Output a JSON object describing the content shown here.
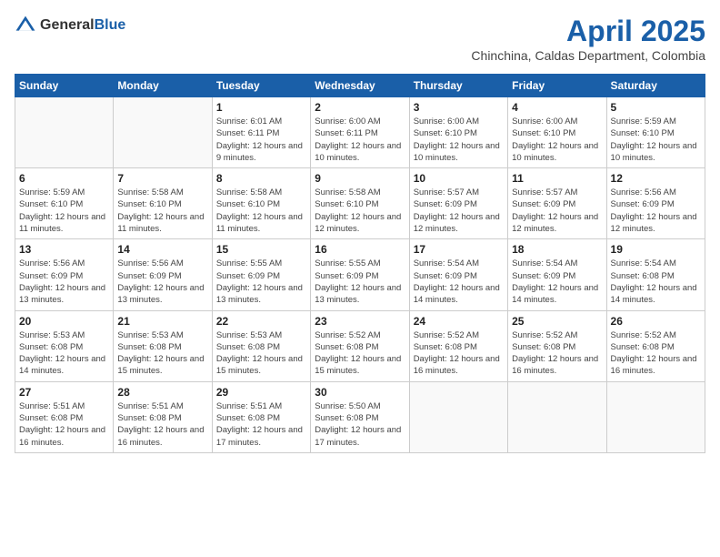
{
  "header": {
    "logo_general": "General",
    "logo_blue": "Blue",
    "month_year": "April 2025",
    "location": "Chinchina, Caldas Department, Colombia"
  },
  "days_of_week": [
    "Sunday",
    "Monday",
    "Tuesday",
    "Wednesday",
    "Thursday",
    "Friday",
    "Saturday"
  ],
  "weeks": [
    [
      {
        "day": "",
        "info": ""
      },
      {
        "day": "",
        "info": ""
      },
      {
        "day": "1",
        "info": "Sunrise: 6:01 AM\nSunset: 6:11 PM\nDaylight: 12 hours and 9 minutes."
      },
      {
        "day": "2",
        "info": "Sunrise: 6:00 AM\nSunset: 6:11 PM\nDaylight: 12 hours and 10 minutes."
      },
      {
        "day": "3",
        "info": "Sunrise: 6:00 AM\nSunset: 6:10 PM\nDaylight: 12 hours and 10 minutes."
      },
      {
        "day": "4",
        "info": "Sunrise: 6:00 AM\nSunset: 6:10 PM\nDaylight: 12 hours and 10 minutes."
      },
      {
        "day": "5",
        "info": "Sunrise: 5:59 AM\nSunset: 6:10 PM\nDaylight: 12 hours and 10 minutes."
      }
    ],
    [
      {
        "day": "6",
        "info": "Sunrise: 5:59 AM\nSunset: 6:10 PM\nDaylight: 12 hours and 11 minutes."
      },
      {
        "day": "7",
        "info": "Sunrise: 5:58 AM\nSunset: 6:10 PM\nDaylight: 12 hours and 11 minutes."
      },
      {
        "day": "8",
        "info": "Sunrise: 5:58 AM\nSunset: 6:10 PM\nDaylight: 12 hours and 11 minutes."
      },
      {
        "day": "9",
        "info": "Sunrise: 5:58 AM\nSunset: 6:10 PM\nDaylight: 12 hours and 12 minutes."
      },
      {
        "day": "10",
        "info": "Sunrise: 5:57 AM\nSunset: 6:09 PM\nDaylight: 12 hours and 12 minutes."
      },
      {
        "day": "11",
        "info": "Sunrise: 5:57 AM\nSunset: 6:09 PM\nDaylight: 12 hours and 12 minutes."
      },
      {
        "day": "12",
        "info": "Sunrise: 5:56 AM\nSunset: 6:09 PM\nDaylight: 12 hours and 12 minutes."
      }
    ],
    [
      {
        "day": "13",
        "info": "Sunrise: 5:56 AM\nSunset: 6:09 PM\nDaylight: 12 hours and 13 minutes."
      },
      {
        "day": "14",
        "info": "Sunrise: 5:56 AM\nSunset: 6:09 PM\nDaylight: 12 hours and 13 minutes."
      },
      {
        "day": "15",
        "info": "Sunrise: 5:55 AM\nSunset: 6:09 PM\nDaylight: 12 hours and 13 minutes."
      },
      {
        "day": "16",
        "info": "Sunrise: 5:55 AM\nSunset: 6:09 PM\nDaylight: 12 hours and 13 minutes."
      },
      {
        "day": "17",
        "info": "Sunrise: 5:54 AM\nSunset: 6:09 PM\nDaylight: 12 hours and 14 minutes."
      },
      {
        "day": "18",
        "info": "Sunrise: 5:54 AM\nSunset: 6:09 PM\nDaylight: 12 hours and 14 minutes."
      },
      {
        "day": "19",
        "info": "Sunrise: 5:54 AM\nSunset: 6:08 PM\nDaylight: 12 hours and 14 minutes."
      }
    ],
    [
      {
        "day": "20",
        "info": "Sunrise: 5:53 AM\nSunset: 6:08 PM\nDaylight: 12 hours and 14 minutes."
      },
      {
        "day": "21",
        "info": "Sunrise: 5:53 AM\nSunset: 6:08 PM\nDaylight: 12 hours and 15 minutes."
      },
      {
        "day": "22",
        "info": "Sunrise: 5:53 AM\nSunset: 6:08 PM\nDaylight: 12 hours and 15 minutes."
      },
      {
        "day": "23",
        "info": "Sunrise: 5:52 AM\nSunset: 6:08 PM\nDaylight: 12 hours and 15 minutes."
      },
      {
        "day": "24",
        "info": "Sunrise: 5:52 AM\nSunset: 6:08 PM\nDaylight: 12 hours and 16 minutes."
      },
      {
        "day": "25",
        "info": "Sunrise: 5:52 AM\nSunset: 6:08 PM\nDaylight: 12 hours and 16 minutes."
      },
      {
        "day": "26",
        "info": "Sunrise: 5:52 AM\nSunset: 6:08 PM\nDaylight: 12 hours and 16 minutes."
      }
    ],
    [
      {
        "day": "27",
        "info": "Sunrise: 5:51 AM\nSunset: 6:08 PM\nDaylight: 12 hours and 16 minutes."
      },
      {
        "day": "28",
        "info": "Sunrise: 5:51 AM\nSunset: 6:08 PM\nDaylight: 12 hours and 16 minutes."
      },
      {
        "day": "29",
        "info": "Sunrise: 5:51 AM\nSunset: 6:08 PM\nDaylight: 12 hours and 17 minutes."
      },
      {
        "day": "30",
        "info": "Sunrise: 5:50 AM\nSunset: 6:08 PM\nDaylight: 12 hours and 17 minutes."
      },
      {
        "day": "",
        "info": ""
      },
      {
        "day": "",
        "info": ""
      },
      {
        "day": "",
        "info": ""
      }
    ]
  ]
}
